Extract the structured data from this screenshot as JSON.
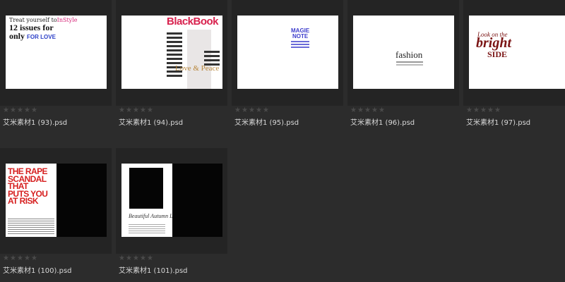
{
  "files": [
    {
      "name": "艾米素材1 (93).psd",
      "rating": 0
    },
    {
      "name": "艾米素材1 (94).psd",
      "rating": 0
    },
    {
      "name": "艾米素材1 (95).psd",
      "rating": 0
    },
    {
      "name": "艾米素材1 (96).psd",
      "rating": 0
    },
    {
      "name": "艾米素材1 (97).psd",
      "rating": 0
    },
    {
      "name": "艾米素材1 (100).psd",
      "rating": 0
    },
    {
      "name": "艾米素材1 (101).psd",
      "rating": 0
    }
  ],
  "thumbnails": {
    "t1": {
      "line1": "Treat yourself to",
      "brand": "InStyle",
      "line2": "12 issues for",
      "line3": "only",
      "highlight": "FOR LOVE"
    },
    "t2": {
      "masthead": "BlackBook",
      "tagline": "Love & Peace"
    },
    "t3": {
      "line1": "MAGIE",
      "line2": "NOTE"
    },
    "t4": {
      "title": "fashion"
    },
    "t5": {
      "line1": "Look on the",
      "line2": "bright",
      "line3": "SIDE"
    },
    "t6": {
      "line1": "THE RAPE",
      "line2": "SCANDAL",
      "line3": "THAT",
      "line4": "PUTS YOU",
      "line5": "AT RISK"
    },
    "t7": {
      "signature": "Beautiful Autumn Leaves"
    }
  },
  "rating_icon": "star-icon",
  "colors": {
    "background": "#2c2c2c",
    "tile": "#242424",
    "filename": "#d8d8d8",
    "star": "#4a4a4a"
  }
}
